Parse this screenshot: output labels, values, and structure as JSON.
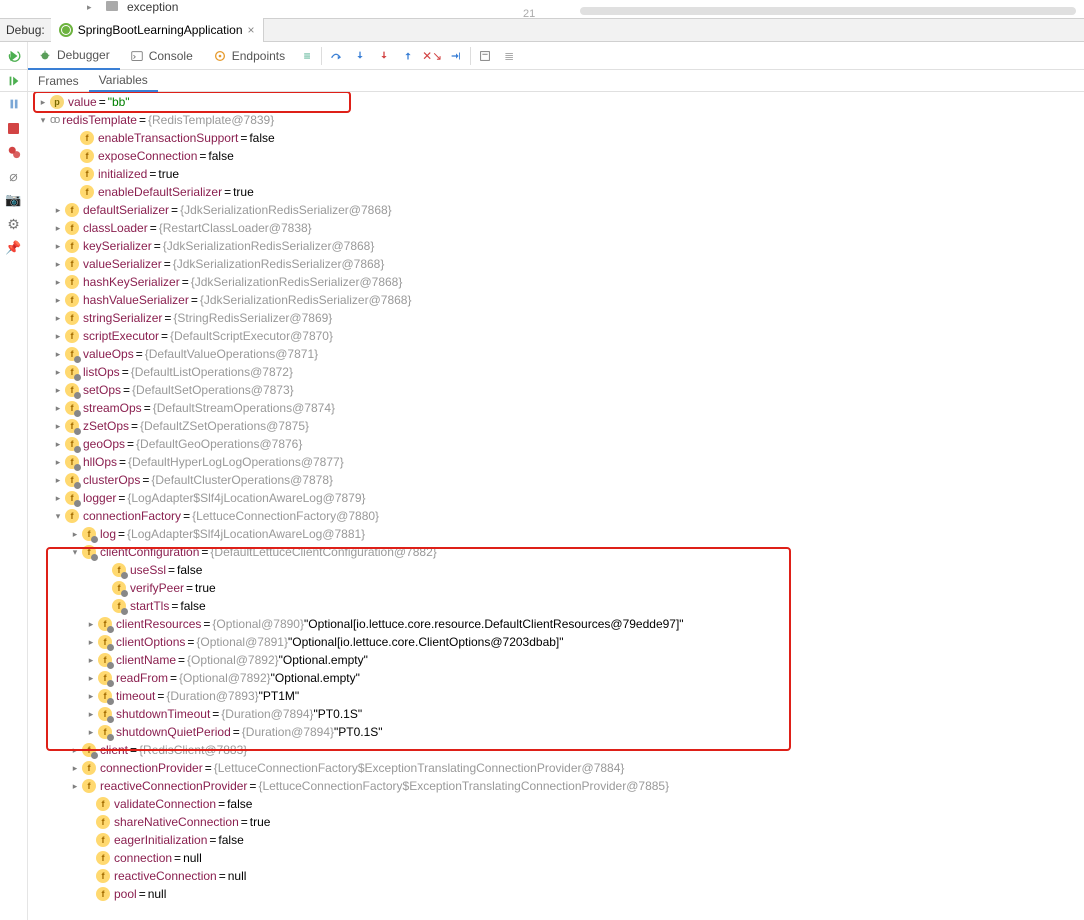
{
  "top": {
    "folder": "exception",
    "lineno": "21"
  },
  "debug": {
    "label": "Debug:",
    "tab": "SpringBootLearningApplication"
  },
  "tooltabs": {
    "debugger": "Debugger",
    "console": "Console",
    "endpoints": "Endpoints"
  },
  "subtabs": {
    "frames": "Frames",
    "variables": "Variables"
  },
  "tree": {
    "value": {
      "k": "value",
      "v": "\"bb\""
    },
    "redisTemplate": {
      "k": "redisTemplate",
      "v": "{RedisTemplate@7839}"
    },
    "enableTransactionSupport": {
      "k": "enableTransactionSupport",
      "v": "false"
    },
    "exposeConnection": {
      "k": "exposeConnection",
      "v": "false"
    },
    "initialized": {
      "k": "initialized",
      "v": "true"
    },
    "enableDefaultSerializer": {
      "k": "enableDefaultSerializer",
      "v": "true"
    },
    "defaultSerializer": {
      "k": "defaultSerializer",
      "v": "{JdkSerializationRedisSerializer@7868}"
    },
    "classLoader": {
      "k": "classLoader",
      "v": "{RestartClassLoader@7838}"
    },
    "keySerializer": {
      "k": "keySerializer",
      "v": "{JdkSerializationRedisSerializer@7868}"
    },
    "valueSerializer": {
      "k": "valueSerializer",
      "v": "{JdkSerializationRedisSerializer@7868}"
    },
    "hashKeySerializer": {
      "k": "hashKeySerializer",
      "v": "{JdkSerializationRedisSerializer@7868}"
    },
    "hashValueSerializer": {
      "k": "hashValueSerializer",
      "v": "{JdkSerializationRedisSerializer@7868}"
    },
    "stringSerializer": {
      "k": "stringSerializer",
      "v": "{StringRedisSerializer@7869}"
    },
    "scriptExecutor": {
      "k": "scriptExecutor",
      "v": "{DefaultScriptExecutor@7870}"
    },
    "valueOps": {
      "k": "valueOps",
      "v": "{DefaultValueOperations@7871}"
    },
    "listOps": {
      "k": "listOps",
      "v": "{DefaultListOperations@7872}"
    },
    "setOps": {
      "k": "setOps",
      "v": "{DefaultSetOperations@7873}"
    },
    "streamOps": {
      "k": "streamOps",
      "v": "{DefaultStreamOperations@7874}"
    },
    "zSetOps": {
      "k": "zSetOps",
      "v": "{DefaultZSetOperations@7875}"
    },
    "geoOps": {
      "k": "geoOps",
      "v": "{DefaultGeoOperations@7876}"
    },
    "hllOps": {
      "k": "hllOps",
      "v": "{DefaultHyperLogLogOperations@7877}"
    },
    "clusterOps": {
      "k": "clusterOps",
      "v": "{DefaultClusterOperations@7878}"
    },
    "logger": {
      "k": "logger",
      "v": "{LogAdapter$Slf4jLocationAwareLog@7879}"
    },
    "connectionFactory": {
      "k": "connectionFactory",
      "v": "{LettuceConnectionFactory@7880}"
    },
    "log": {
      "k": "log",
      "v": "{LogAdapter$Slf4jLocationAwareLog@7881}"
    },
    "clientConfiguration": {
      "k": "clientConfiguration",
      "v": "{DefaultLettuceClientConfiguration@7882}"
    },
    "useSsl": {
      "k": "useSsl",
      "v": "false"
    },
    "verifyPeer": {
      "k": "verifyPeer",
      "v": "true"
    },
    "startTls": {
      "k": "startTls",
      "v": "false"
    },
    "clientResources": {
      "k": "clientResources",
      "o": "{Optional@7890}",
      "s": "\"Optional[io.lettuce.core.resource.DefaultClientResources@79edde97]\""
    },
    "clientOptions": {
      "k": "clientOptions",
      "o": "{Optional@7891}",
      "s": "\"Optional[io.lettuce.core.ClientOptions@7203dbab]\""
    },
    "clientName": {
      "k": "clientName",
      "o": "{Optional@7892}",
      "s": "\"Optional.empty\""
    },
    "readFrom": {
      "k": "readFrom",
      "o": "{Optional@7892}",
      "s": "\"Optional.empty\""
    },
    "timeout": {
      "k": "timeout",
      "o": "{Duration@7893}",
      "s": "\"PT1M\""
    },
    "shutdownTimeout": {
      "k": "shutdownTimeout",
      "o": "{Duration@7894}",
      "s": "\"PT0.1S\""
    },
    "shutdownQuietPeriod": {
      "k": "shutdownQuietPeriod",
      "o": "{Duration@7894}",
      "s": "\"PT0.1S\""
    },
    "client": {
      "k": "client",
      "v": "{RedisClient@7883}"
    },
    "connectionProvider": {
      "k": "connectionProvider",
      "v": "{LettuceConnectionFactory$ExceptionTranslatingConnectionProvider@7884}"
    },
    "reactiveConnectionProvider": {
      "k": "reactiveConnectionProvider",
      "v": "{LettuceConnectionFactory$ExceptionTranslatingConnectionProvider@7885}"
    },
    "validateConnection": {
      "k": "validateConnection",
      "v": "false"
    },
    "shareNativeConnection": {
      "k": "shareNativeConnection",
      "v": "true"
    },
    "eagerInitialization": {
      "k": "eagerInitialization",
      "v": "false"
    },
    "connection": {
      "k": "connection",
      "v": "null"
    },
    "reactiveConnection": {
      "k": "reactiveConnection",
      "v": "null"
    },
    "pool": {
      "k": "pool",
      "v": "null"
    }
  }
}
